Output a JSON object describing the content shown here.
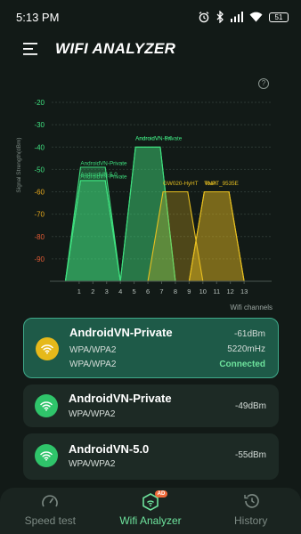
{
  "status_bar": {
    "time": "5:13 PM",
    "battery": "51"
  },
  "header": {
    "title": "WIFI ANALYZER"
  },
  "help": {
    "label": "?"
  },
  "chart_data": {
    "type": "area",
    "ylabel": "Signal Strength(dBm)",
    "xlabel": "Wifi channels",
    "yticks": [
      -20,
      -30,
      -40,
      -50,
      -60,
      -70,
      -80,
      -90
    ],
    "ytick_colors": [
      "#3fe07f",
      "#3fe07f",
      "#3fe07f",
      "#3fe07f",
      "#e8a91c",
      "#e8a91c",
      "#e05a34",
      "#e05a34"
    ],
    "xticks": [
      1,
      2,
      3,
      4,
      5,
      6,
      7,
      8,
      9,
      10,
      11,
      12,
      13
    ],
    "ylim": [
      -100,
      -20
    ],
    "xlim": [
      -1,
      15
    ],
    "series": [
      {
        "name": "AndroidVN-Private",
        "channel": 2,
        "dbm": -49,
        "color": "#3fe07f",
        "label_y": -48
      },
      {
        "name": "AndroidVN-5.0",
        "channel": 2,
        "dbm": -55,
        "color": "#3fe07f",
        "label_y": -53
      },
      {
        "name": "AndroidVN-Private",
        "channel": 2,
        "dbm": -55,
        "color": "#3fe07f",
        "label_y": -54
      },
      {
        "name": "AndroidVN-Private",
        "channel": 6,
        "dbm": -40,
        "color": "#3fe07f",
        "label_y": -37
      },
      {
        "name": "AndroidVN-5.0",
        "channel": 6,
        "dbm": -40,
        "color": "#3fe07f",
        "label_y": -37
      },
      {
        "name": "GW020-HyHT",
        "channel": 8,
        "dbm": -60,
        "color": "#e8c020",
        "label_y": -57
      },
      {
        "name": "VNPT_9535E",
        "channel": 11,
        "dbm": -60,
        "color": "#e8c020",
        "label_y": -57
      },
      {
        "name": "Toan",
        "channel": 11,
        "dbm": -60,
        "color": "#e8c020",
        "label_y": -57
      }
    ]
  },
  "networks": [
    {
      "ssid": "AndroidVN-Private",
      "security": "WPA/WPA2",
      "security2": "WPA/WPA2",
      "dbm": "-61dBm",
      "freq": "5220mHz",
      "status": "Connected",
      "icon": "wifi-icon",
      "color": "#e6b91a"
    },
    {
      "ssid": "AndroidVN-Private",
      "security": "WPA/WPA2",
      "dbm": "-49dBm",
      "icon": "wifi-icon",
      "color": "#2fc46a"
    },
    {
      "ssid": "AndroidVN-5.0",
      "security": "WPA/WPA2",
      "dbm": "-55dBm",
      "icon": "wifi-icon",
      "color": "#2fc46a"
    }
  ],
  "nav": {
    "items": [
      {
        "label": "Speed test",
        "icon": "speedometer-icon"
      },
      {
        "label": "Wifi Analyzer",
        "icon": "wifi-analyzer-icon",
        "badge": "AD"
      },
      {
        "label": "History",
        "icon": "history-icon"
      }
    ]
  }
}
